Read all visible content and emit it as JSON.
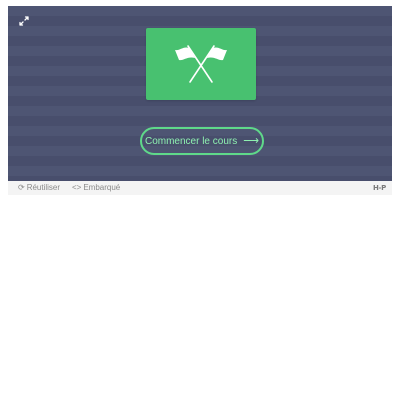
{
  "player": {
    "fullscreen_icon": "expand-icon",
    "background_color": "#4a5170",
    "badge": {
      "icon": "crossed-flags-icon",
      "color": "#48c170"
    },
    "start_button": {
      "label": "Commencer le cours",
      "arrow": "⟶",
      "accent": "#5fd98a"
    }
  },
  "actions": {
    "reuse": {
      "icon": "⟳",
      "label": "Réutiliser"
    },
    "embed": {
      "icon": "<>",
      "label": "Embarqué"
    },
    "h5p_logo": "H-P"
  }
}
